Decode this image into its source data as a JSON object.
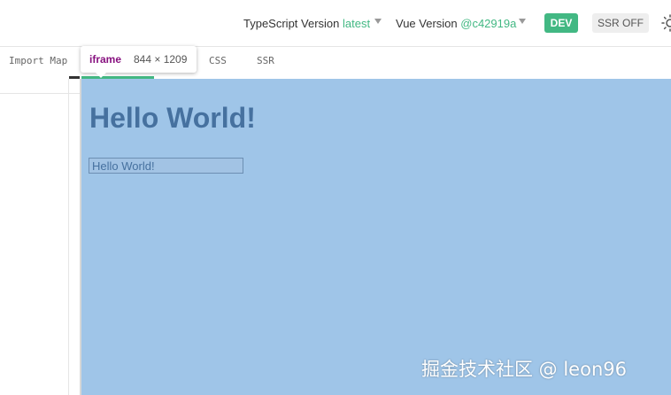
{
  "header": {
    "ts_label": "TypeScript Version",
    "ts_value": "latest",
    "vue_label": "Vue Version",
    "vue_value": "@c42919a",
    "dev_badge": "DEV",
    "ssr_toggle": "SSR OFF",
    "accent_color": "#42b883",
    "theme_icon": "sun-icon"
  },
  "tabs": {
    "import_map": "Import Map",
    "css": "CSS",
    "ssr": "SSR"
  },
  "tooltip": {
    "tag": "iframe",
    "dims": "844 × 1209"
  },
  "preview": {
    "heading": "Hello World!",
    "input_value": "Hello World!",
    "background": "#9fc5e8"
  },
  "watermark": "掘金技术社区 @ leon96"
}
